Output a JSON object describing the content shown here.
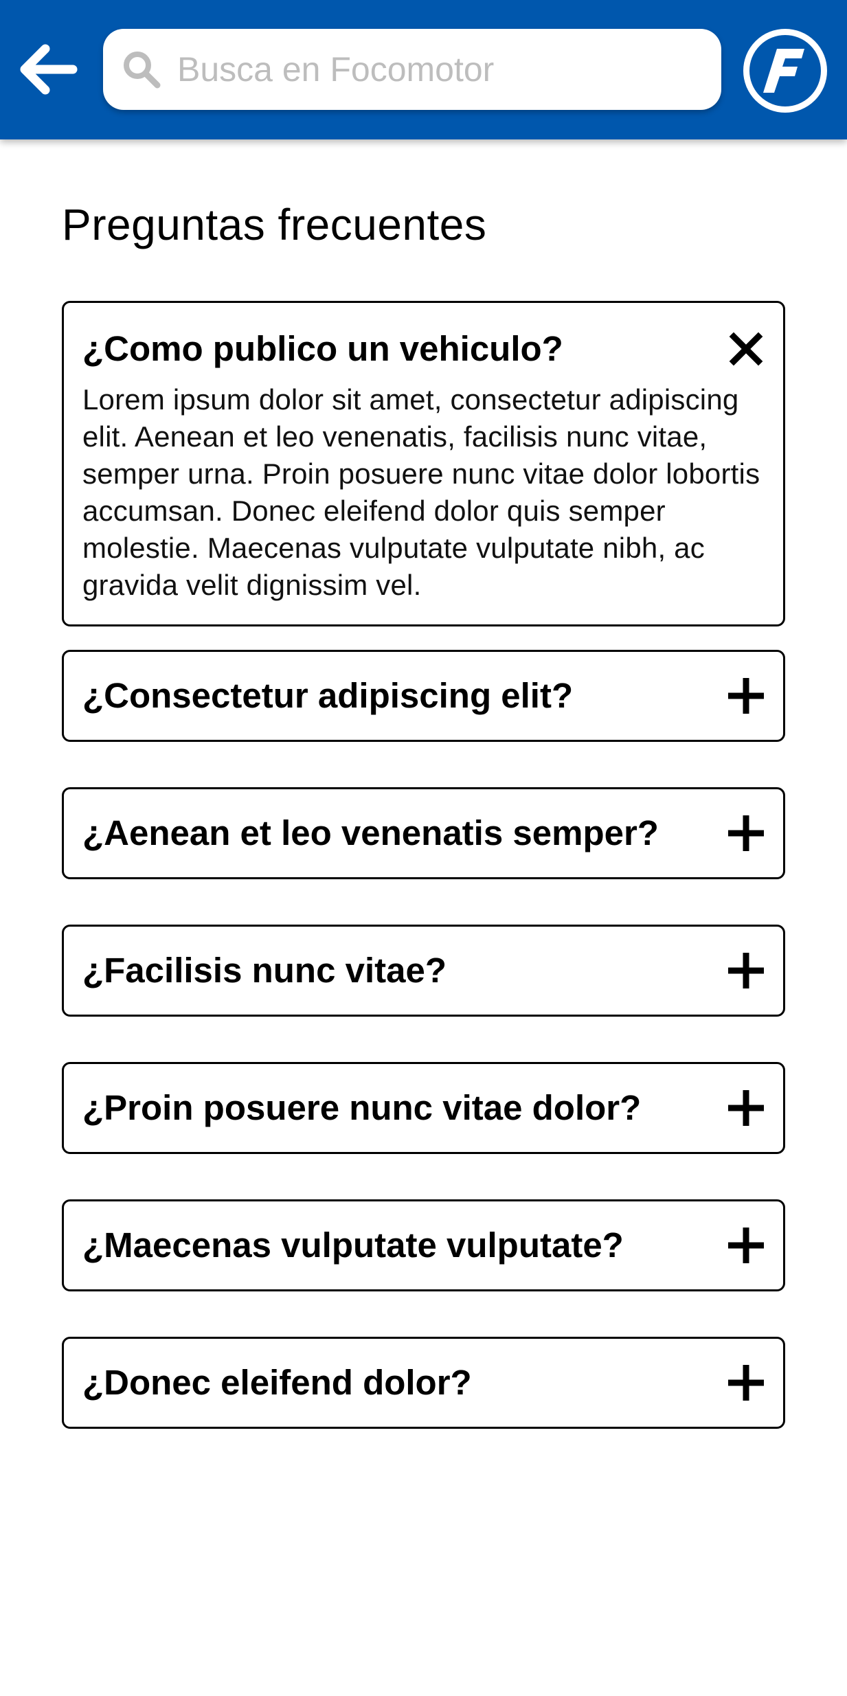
{
  "header": {
    "back_icon": "arrow-left-icon",
    "search": {
      "icon": "search-icon",
      "placeholder": "Busca en Focomotor",
      "value": ""
    },
    "logo": {
      "icon": "focomotor-logo",
      "letter": "F"
    }
  },
  "colors": {
    "primary": "#0057ad",
    "placeholder": "#bdbdbd",
    "border": "#000000"
  },
  "main": {
    "title": "Preguntas frecuentes",
    "faqs": [
      {
        "question": "¿Como publico un vehiculo?",
        "expanded": true,
        "toggle_icon": "close-icon",
        "answer": "Lorem ipsum dolor sit amet, consectetur adipiscing elit. Aenean et leo venenatis, facilisis nunc vitae, semper urna. Proin posuere nunc vitae dolor lobortis accumsan. Donec eleifend dolor quis semper molestie. Maecenas vulputate vulputate nibh, ac gravida velit dignissim vel."
      },
      {
        "question": "¿Consectetur adipiscing elit?",
        "expanded": false,
        "toggle_icon": "plus-icon"
      },
      {
        "question": "¿Aenean et leo venenatis semper?",
        "expanded": false,
        "toggle_icon": "plus-icon"
      },
      {
        "question": "¿Facilisis nunc vitae?",
        "expanded": false,
        "toggle_icon": "plus-icon"
      },
      {
        "question": "¿Proin posuere nunc vitae dolor?",
        "expanded": false,
        "toggle_icon": "plus-icon"
      },
      {
        "question": "¿Maecenas vulputate vulputate?",
        "expanded": false,
        "toggle_icon": "plus-icon"
      },
      {
        "question": "¿Donec eleifend dolor?",
        "expanded": false,
        "toggle_icon": "plus-icon"
      }
    ]
  }
}
